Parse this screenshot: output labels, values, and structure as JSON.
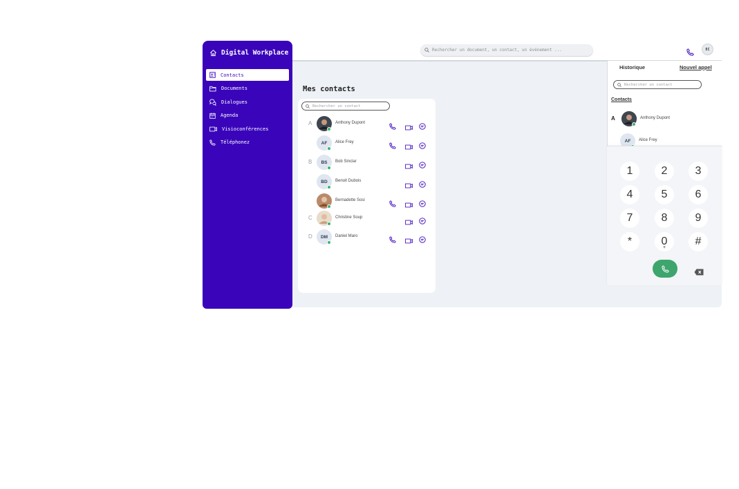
{
  "app": {
    "title": "Digital Workplace"
  },
  "sidebar": {
    "items": [
      {
        "label": "Contacts",
        "icon": "contacts-icon",
        "active": true
      },
      {
        "label": "Documents",
        "icon": "folder-icon"
      },
      {
        "label": "Dialogues",
        "icon": "chat-icon"
      },
      {
        "label": "Agenda",
        "icon": "calendar-icon"
      },
      {
        "label": "Visioconférences",
        "icon": "video-icon"
      },
      {
        "label": "Téléphonez",
        "icon": "phone-icon"
      }
    ]
  },
  "header": {
    "search_placeholder": "Rechercher un document, un contact, un événement ...",
    "user_initials": "EC"
  },
  "main": {
    "title": "Mes contacts",
    "search_placeholder": "Rechercher un contact",
    "contacts": [
      {
        "letter": "A",
        "name": "Anthony Dupont",
        "initials": "",
        "photo": true,
        "phone": true,
        "video": true,
        "chat": true
      },
      {
        "letter": "",
        "name": "Alice Frey",
        "initials": "AF",
        "photo": false,
        "phone": true,
        "video": true,
        "chat": true
      },
      {
        "letter": "B",
        "name": "Bob Sinclar",
        "initials": "BS",
        "photo": false,
        "phone": false,
        "video": true,
        "chat": true
      },
      {
        "letter": "",
        "name": "Benoit Dubois",
        "initials": "BD",
        "photo": false,
        "phone": false,
        "video": true,
        "chat": true
      },
      {
        "letter": "",
        "name": "Bernadette Sosi",
        "initials": "",
        "photo": true,
        "phone": true,
        "video": true,
        "chat": true
      },
      {
        "letter": "C",
        "name": "Christine Soup",
        "initials": "",
        "photo": true,
        "phone": false,
        "video": true,
        "chat": true
      },
      {
        "letter": "D",
        "name": "Daniel Maro",
        "initials": "DM",
        "photo": false,
        "phone": true,
        "video": true,
        "chat": true
      }
    ]
  },
  "phone_panel": {
    "tab_history": "Historique",
    "tab_new_call": "Nouvel appel",
    "search_placeholder": "Rechercher un contact",
    "section_label": "Contacts",
    "contacts": [
      {
        "letter": "A",
        "name": "Anthony Dupont",
        "initials": ""
      },
      {
        "letter": "",
        "name": "Alice Frey",
        "initials": "AF"
      }
    ],
    "keys": [
      "1",
      "2",
      "3",
      "4",
      "5",
      "6",
      "7",
      "8",
      "9",
      "*",
      "0",
      "#"
    ],
    "zero_sub": "+"
  },
  "colors": {
    "brand": "#3a05ba",
    "call_green": "#3ea56d",
    "online": "#3bb273"
  }
}
